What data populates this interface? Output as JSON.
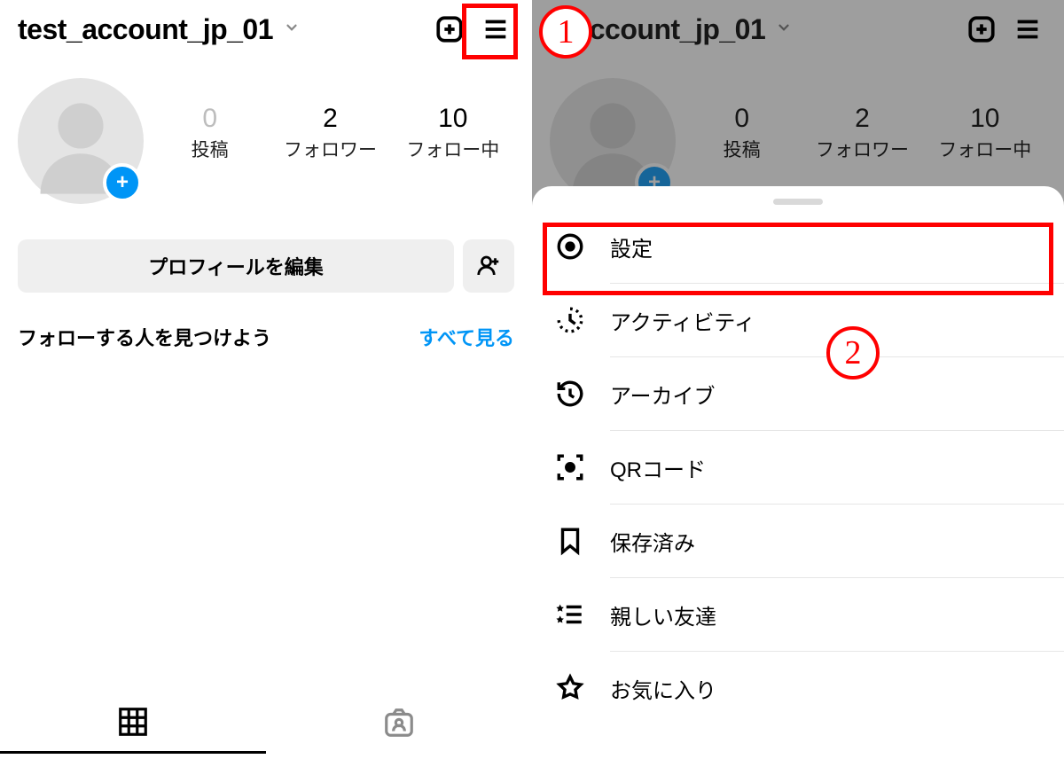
{
  "left": {
    "username": "test_account_jp_01",
    "stats": {
      "posts": {
        "count": "0",
        "label": "投稿"
      },
      "followers": {
        "count": "2",
        "label": "フォロワー"
      },
      "following": {
        "count": "10",
        "label": "フォロー中"
      }
    },
    "edit_profile_label": "プロフィールを編集",
    "discover_label": "フォローする人を見つけよう",
    "see_all_label": "すべて見る"
  },
  "right": {
    "username_partial": "t_account_jp_01",
    "stats": {
      "posts": {
        "count": "0",
        "label": "投稿"
      },
      "followers": {
        "count": "2",
        "label": "フォロワー"
      },
      "following": {
        "count": "10",
        "label": "フォロー中"
      }
    },
    "menu": [
      {
        "icon": "settings-icon",
        "label": "設定"
      },
      {
        "icon": "activity-icon",
        "label": "アクティビティ"
      },
      {
        "icon": "archive-icon",
        "label": "アーカイブ"
      },
      {
        "icon": "qr-icon",
        "label": "QRコード"
      },
      {
        "icon": "bookmark-icon",
        "label": "保存済み"
      },
      {
        "icon": "close-friends-icon",
        "label": "親しい友達"
      },
      {
        "icon": "star-icon",
        "label": "お気に入り"
      }
    ]
  },
  "annotations": {
    "step1": "1",
    "step2": "2"
  }
}
